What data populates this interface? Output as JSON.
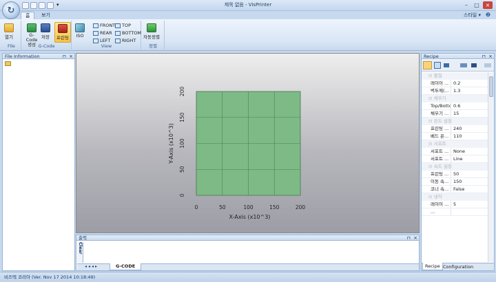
{
  "window": {
    "title": "제목 없음 - VisPrinter",
    "style_menu": "스타일"
  },
  "ribbon": {
    "tabs": [
      "홈",
      "보기"
    ],
    "groups": {
      "file": {
        "label": "File",
        "open": "열기"
      },
      "gcode": {
        "label": "G-Code",
        "generate": "G-Code 생성",
        "save": "저장",
        "print": "프린팅"
      },
      "view": {
        "label": "View",
        "iso": "ISO",
        "front": "FRONT",
        "top": "TOP",
        "rear": "REAR",
        "bottom": "BOTTOM",
        "left": "LEFT",
        "right": "RIGHT"
      },
      "arrange": {
        "label": "정렬",
        "auto_arrange": "자동정렬"
      }
    }
  },
  "left_panel": {
    "title": "File Information"
  },
  "viewport": {
    "x_axis_label": "X-Axis (x10^3)",
    "y_axis_label": "Y-Axis (x10^3)",
    "x_ticks": [
      "0",
      "50",
      "100",
      "150",
      "200"
    ],
    "y_ticks": [
      "0",
      "50",
      "100",
      "150",
      "200"
    ],
    "bed_color": "#7dba86"
  },
  "output_panel": {
    "title": "출력",
    "clear_button": "Clear",
    "tab": "G-CODE"
  },
  "recipe": {
    "title": "Recipe",
    "groups": [
      {
        "name": "품질",
        "props": [
          {
            "name": "레이어 ...",
            "value": "0.2"
          },
          {
            "name": "벽두께(...",
            "value": "1.3"
          }
        ]
      },
      {
        "name": "채우기",
        "props": [
          {
            "name": "Top/Botto...",
            "value": "0.6"
          },
          {
            "name": "채우기 ...",
            "value": "15"
          }
        ]
      },
      {
        "name": "온도 설정",
        "props": [
          {
            "name": "프린팅 ...",
            "value": "240"
          },
          {
            "name": "베드 온...",
            "value": "110"
          }
        ]
      },
      {
        "name": "서포트",
        "props": [
          {
            "name": "서포트 ...",
            "value": "None"
          },
          {
            "name": "서포트 ...",
            "value": "Line"
          }
        ]
      },
      {
        "name": "속도 설정",
        "props": [
          {
            "name": "프린팅 ...",
            "value": "50"
          },
          {
            "name": "이동 속...",
            "value": "150"
          },
          {
            "name": "코너 속...",
            "value": "False"
          }
        ]
      },
      {
        "name": "냉각",
        "props": [
          {
            "name": "레이어 ...",
            "value": "5"
          },
          {
            "name": "...",
            "value": ""
          }
        ]
      }
    ],
    "tabs": [
      "Recipe",
      "Configuration"
    ]
  },
  "status": {
    "text": "비즈텍 코리아 (Ver. Nov 17 2014 10:18:49)"
  }
}
